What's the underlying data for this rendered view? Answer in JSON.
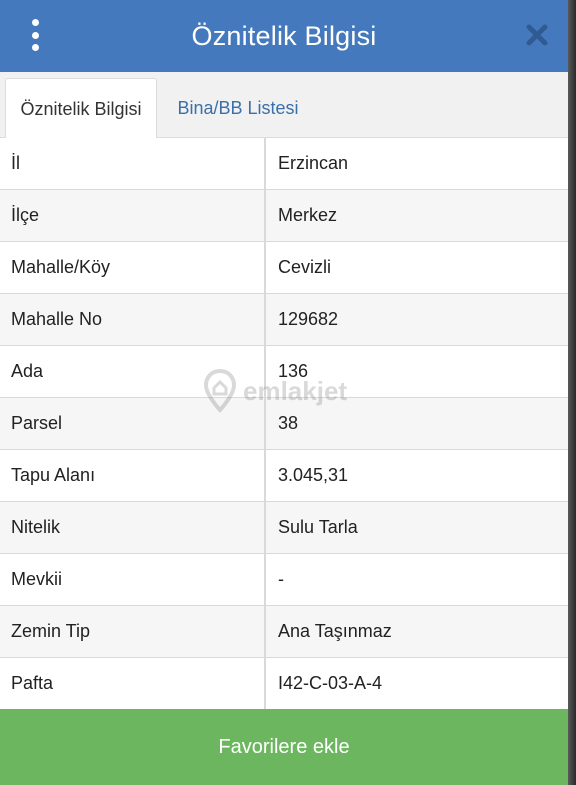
{
  "header": {
    "title": "Öznitelik Bilgisi",
    "menu_icon": "vertical-dots-icon",
    "close_icon": "close-icon",
    "color": "#4479bd"
  },
  "tabs": [
    {
      "label": "Öznitelik Bilgisi",
      "active": true
    },
    {
      "label": "Bina/BB Listesi",
      "active": false
    }
  ],
  "attributes": [
    {
      "key": "İl",
      "value": "Erzincan"
    },
    {
      "key": "İlçe",
      "value": "Merkez"
    },
    {
      "key": "Mahalle/Köy",
      "value": "Cevizli"
    },
    {
      "key": "Mahalle No",
      "value": "129682"
    },
    {
      "key": "Ada",
      "value": "136"
    },
    {
      "key": "Parsel",
      "value": "38"
    },
    {
      "key": "Tapu Alanı",
      "value": "3.045,31"
    },
    {
      "key": "Nitelik",
      "value": "Sulu Tarla"
    },
    {
      "key": "Mevkii",
      "value": "-"
    },
    {
      "key": "Zemin Tip",
      "value": "Ana Taşınmaz"
    },
    {
      "key": "Pafta",
      "value": "I42-C-03-A-4"
    }
  ],
  "watermark": {
    "text": "emlakjet",
    "icon": "location-pin-icon"
  },
  "footer": {
    "button_label": "Favorilere ekle",
    "color": "#6cb65f"
  }
}
